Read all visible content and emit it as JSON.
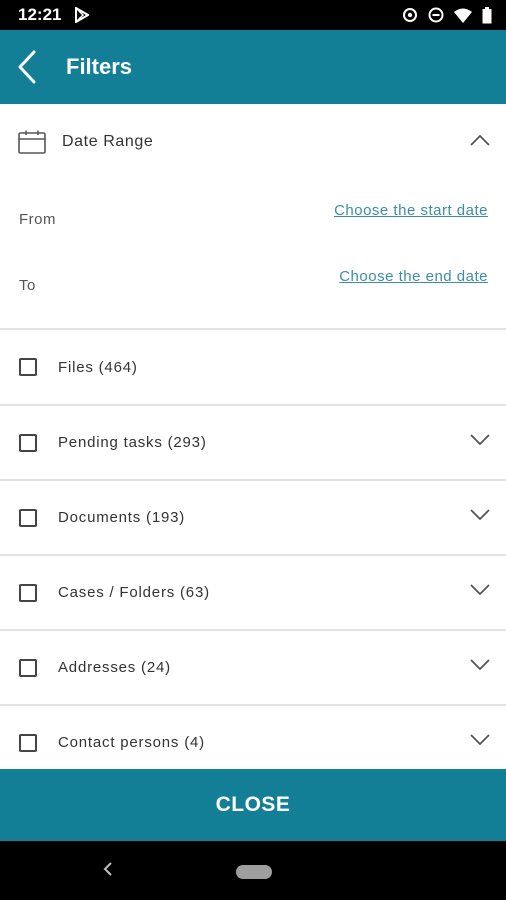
{
  "status_bar": {
    "time": "12:21",
    "icons": [
      "play-store-icon",
      "data-saver-icon",
      "do-not-disturb-icon",
      "wifi-icon",
      "battery-icon"
    ]
  },
  "app_bar": {
    "title": "Filters",
    "back_icon": "back-arrow-icon",
    "color": "#137f97"
  },
  "date_range": {
    "title": "Date Range",
    "icon": "calendar-icon",
    "from_label": "From",
    "from_link": "Choose the start date",
    "to_label": "To",
    "to_link": "Choose the end date",
    "link_color": "#3c8ea4"
  },
  "filters": [
    {
      "label": "Files (464)",
      "checked": false,
      "expandable": false
    },
    {
      "label": "Pending tasks (293)",
      "checked": false,
      "expandable": true
    },
    {
      "label": "Documents (193)",
      "checked": false,
      "expandable": true
    },
    {
      "label": "Cases / Folders (63)",
      "checked": false,
      "expandable": true
    },
    {
      "label": "Addresses (24)",
      "checked": false,
      "expandable": true
    },
    {
      "label": "Contact persons (4)",
      "checked": false,
      "expandable": true
    }
  ],
  "close_button": {
    "label": "CLOSE"
  },
  "nav_bar": {
    "icons": [
      "nav-back-icon",
      "nav-home-pill-icon"
    ]
  }
}
